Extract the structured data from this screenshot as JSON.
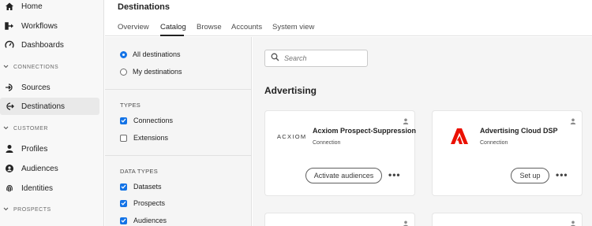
{
  "nav": {
    "items_top": [
      {
        "label": "Home",
        "icon": "home-icon"
      },
      {
        "label": "Workflows",
        "icon": "workflow-icon"
      },
      {
        "label": "Dashboards",
        "icon": "dashboard-icon"
      }
    ],
    "sections": {
      "connections": "CONNECTIONS",
      "customer": "CUSTOMER",
      "prospects": "PROSPECTS"
    },
    "connections_items": [
      {
        "label": "Sources",
        "icon": "sources-icon"
      },
      {
        "label": "Destinations",
        "icon": "destinations-icon",
        "active": true
      }
    ],
    "customer_items": [
      {
        "label": "Profiles",
        "icon": "person-icon"
      },
      {
        "label": "Audiences",
        "icon": "audiences-icon"
      },
      {
        "label": "Identities",
        "icon": "fingerprint-icon"
      }
    ]
  },
  "header": {
    "title": "Destinations",
    "tabs": [
      "Overview",
      "Catalog",
      "Browse",
      "Accounts",
      "System view"
    ],
    "active_tab": "Catalog"
  },
  "filters": {
    "radio": [
      {
        "label": "All destinations",
        "selected": true
      },
      {
        "label": "My destinations",
        "selected": false
      }
    ],
    "types_heading": "TYPES",
    "types": [
      {
        "label": "Connections",
        "checked": true
      },
      {
        "label": "Extensions",
        "checked": false
      }
    ],
    "data_types_heading": "DATA TYPES",
    "data_types": [
      {
        "label": "Datasets",
        "checked": true
      },
      {
        "label": "Prospects",
        "checked": true
      },
      {
        "label": "Audiences",
        "checked": true
      }
    ]
  },
  "main": {
    "search_placeholder": "Search",
    "section_title": "Advertising",
    "cards": [
      {
        "logo_text": "ACXIOM",
        "title": "Acxiom Prospect-Suppression",
        "subtitle": "Connection",
        "action": "Activate audiences",
        "more": "•••"
      },
      {
        "logo": "adobe-icon",
        "title": "Advertising Cloud DSP",
        "subtitle": "Connection",
        "action": "Set up",
        "more": "•••"
      }
    ]
  },
  "colors": {
    "accent": "#1473e6",
    "adobe_red": "#eb1000"
  }
}
